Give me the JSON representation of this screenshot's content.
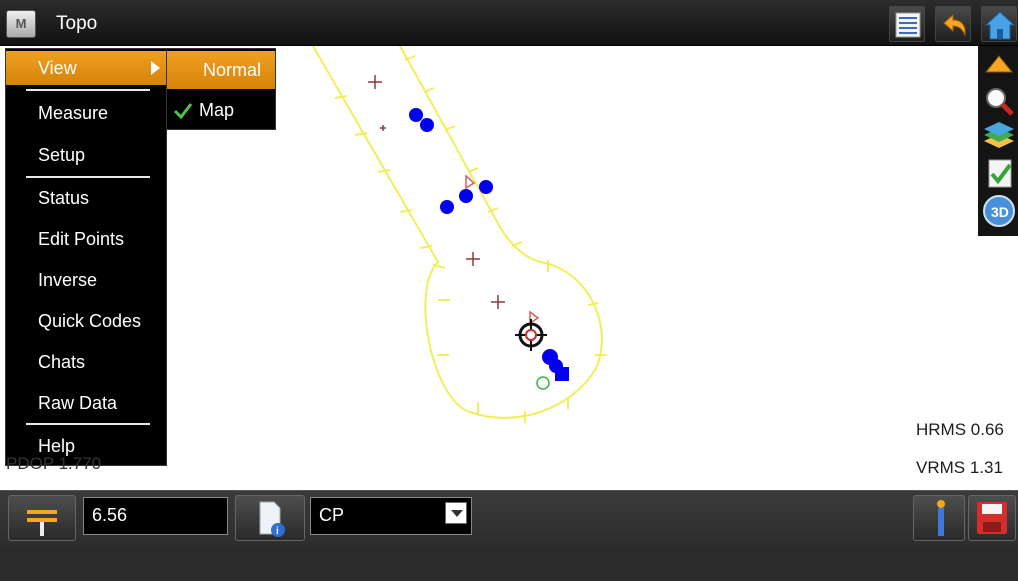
{
  "titlebar": {
    "app_button": "M",
    "title": "Topo"
  },
  "menu": {
    "items": [
      {
        "label": "View",
        "active": true,
        "has_submenu": true
      },
      {
        "label": "Measure"
      },
      {
        "label": "Setup"
      },
      {
        "label": "Status"
      },
      {
        "label": "Edit Points"
      },
      {
        "label": "Inverse"
      },
      {
        "label": "Quick Codes"
      },
      {
        "label": "Chats"
      },
      {
        "label": "Raw Data"
      },
      {
        "label": "Help"
      }
    ]
  },
  "submenu": {
    "items": [
      {
        "label": "Normal",
        "active": true
      },
      {
        "label": "Map",
        "checked": true
      }
    ]
  },
  "status": {
    "pdop": "PDOP 1.770",
    "hrms": "HRMS 0.66",
    "vrms": "VRMS 1.31"
  },
  "bottom": {
    "height_value": "6.56",
    "code_value": "CP"
  },
  "icons": {
    "titlebar": [
      "list-icon",
      "undo-icon",
      "home-icon"
    ],
    "right_toolbar": [
      "pan-up-icon",
      "zoom-icon",
      "layers-icon",
      "check-list-icon",
      "3d-view-icon"
    ],
    "bottom": [
      "rod-height-icon",
      "point-info-icon",
      "instrument-icon",
      "save-icon"
    ]
  },
  "colors": {
    "accent": "#e8940f",
    "alignment_line": "#f2ee5a",
    "survey_point": "#0000ee",
    "marker": "#8b3a3a"
  }
}
